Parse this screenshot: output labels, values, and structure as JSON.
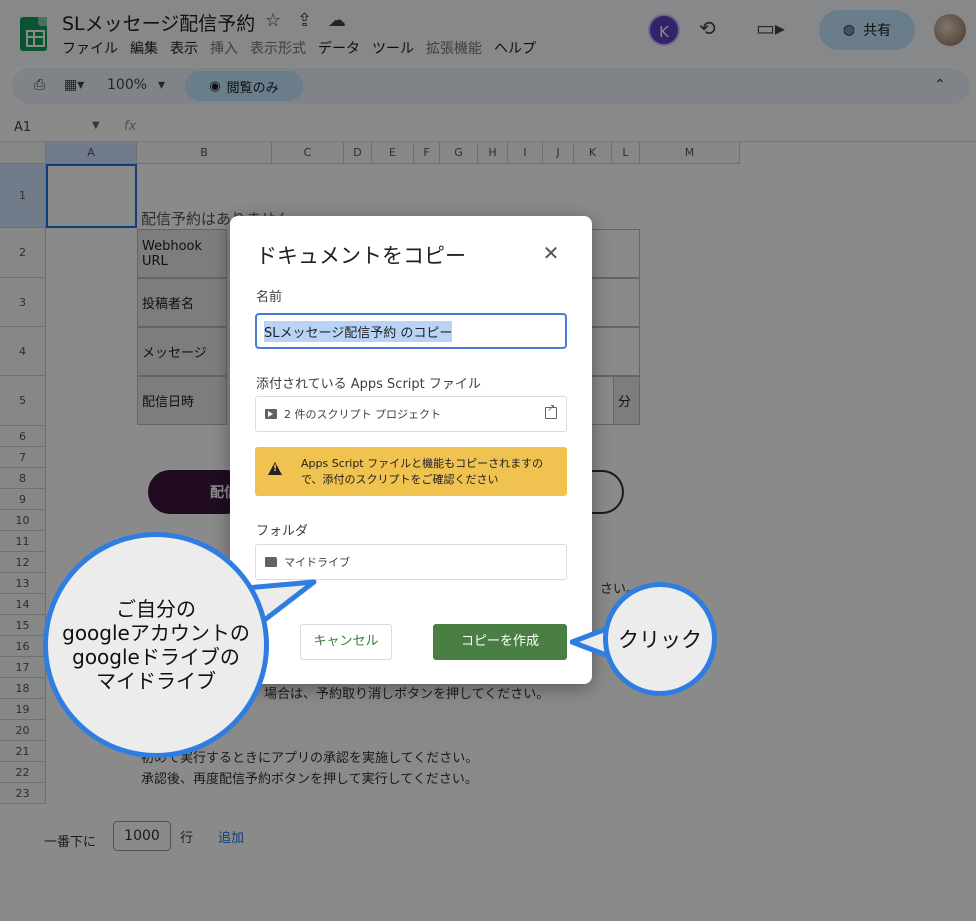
{
  "app": {
    "doc_title": "SLメッセージ配信予約",
    "menu": [
      "ファイル",
      "編集",
      "表示",
      "挿入",
      "表示形式",
      "データ",
      "ツール",
      "拡張機能",
      "ヘルプ"
    ],
    "avatar_initial": "K",
    "share_label": "共有",
    "zoom": "100%",
    "view_only_label": "閲覧のみ",
    "cell_ref": "A1",
    "fx": "fx"
  },
  "sheet": {
    "columns": [
      "A",
      "B",
      "C",
      "D",
      "E",
      "F",
      "G",
      "H",
      "I",
      "J",
      "K",
      "L",
      "M"
    ],
    "rows": [
      "1",
      "2",
      "3",
      "4",
      "5",
      "6",
      "7",
      "8",
      "9",
      "10",
      "11",
      "12",
      "13",
      "14",
      "15",
      "16",
      "17",
      "18",
      "19",
      "20",
      "21",
      "22",
      "23"
    ],
    "no_reservations": "配信予約はありません",
    "labels": [
      "Webhook URL",
      "投稿者名",
      "メッセージ",
      "配信日時"
    ],
    "minute_label": "分",
    "btn_partial": "配信",
    "line_13_tail": "さい。",
    "line_18_tail": "場合は、予約取り消しボタンを押してください。",
    "line_21": "初めて実行するときにアプリの承認を実施してください。",
    "line_22": "承認後、再度配信予約ボタンを押して実行してください。",
    "footer_label": "一番下に",
    "footer_rows": "1000",
    "footer_suffix": "行",
    "footer_add": "追加"
  },
  "dialog": {
    "title": "ドキュメントをコピー",
    "name_label": "名前",
    "name_value": "SLメッセージ配信予約 のコピー",
    "attached_label": "添付されている Apps Script ファイル",
    "attached_value": "2 件のスクリプト プロジェクト",
    "warning": "Apps Script ファイルと機能もコピーされますので、添付のスクリプトをご確認ください",
    "folder_label": "フォルダ",
    "folder_value": "マイドライブ",
    "cancel": "キャンセル",
    "create": "コピーを作成"
  },
  "callouts": {
    "left_line1": "ご自分の",
    "left_line2": "googleアカウントの",
    "left_line3": "googleドライブの",
    "left_line4": "マイドライブ",
    "right": "クリック",
    "border_color": "#2f7de1"
  }
}
